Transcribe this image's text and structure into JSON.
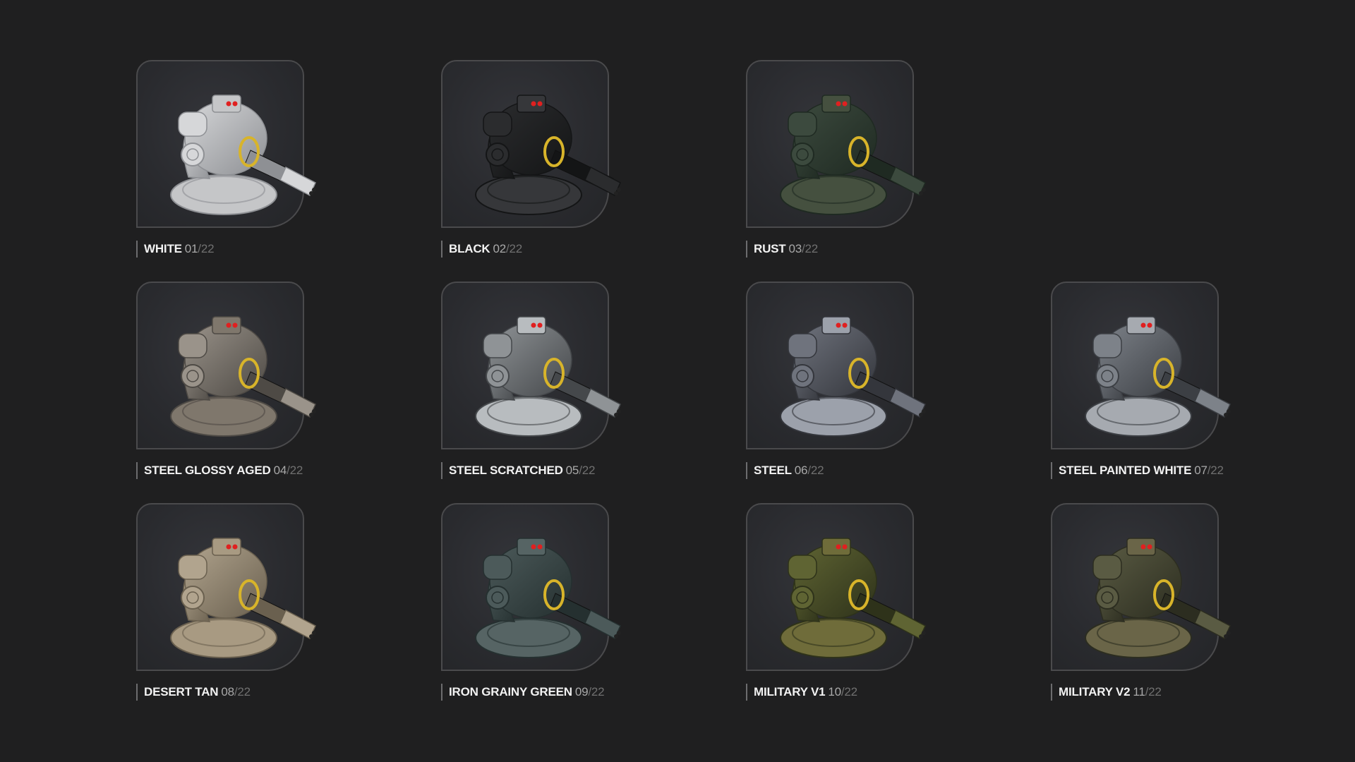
{
  "total": "/22",
  "variants": [
    {
      "name": "WHITE",
      "num": "01",
      "colors": {
        "body": "#d6d7d9",
        "dark": "#8e9094",
        "base": "#c5c6c8"
      }
    },
    {
      "name": "BLACK",
      "num": "02",
      "colors": {
        "body": "#2b2c2e",
        "dark": "#141516",
        "base": "#36373a"
      }
    },
    {
      "name": "RUST",
      "num": "03",
      "colors": {
        "body": "#3c4a3e",
        "dark": "#1f2a22",
        "base": "#45503f"
      }
    },
    {
      "name": "STEEL GLOSSY AGED",
      "num": "04",
      "colors": {
        "body": "#9a938a",
        "dark": "#4e4a45",
        "base": "#7f776c"
      }
    },
    {
      "name": "STEEL SCRATCHED",
      "num": "05",
      "colors": {
        "body": "#8f9396",
        "dark": "#45484b",
        "base": "#b8bcbf"
      }
    },
    {
      "name": "STEEL",
      "num": "06",
      "colors": {
        "body": "#6f737d",
        "dark": "#34363c",
        "base": "#9ca1ab"
      }
    },
    {
      "name": "STEEL PAINTED WHITE",
      "num": "07",
      "colors": {
        "body": "#7d8289",
        "dark": "#3c3f44",
        "base": "#a6aab0"
      }
    },
    {
      "name": "DESERT TAN",
      "num": "08",
      "colors": {
        "body": "#b1a48e",
        "dark": "#6a604f",
        "base": "#a89a82"
      }
    },
    {
      "name": "IRON GRAINY GREEN",
      "num": "09",
      "colors": {
        "body": "#4c5a5a",
        "dark": "#253030",
        "base": "#566464"
      }
    },
    {
      "name": "MILITARY V1",
      "num": "10",
      "colors": {
        "body": "#5f6433",
        "dark": "#2e321a",
        "base": "#6f6c3a"
      }
    },
    {
      "name": "MILITARY V2",
      "num": "11",
      "colors": {
        "body": "#5a5b43",
        "dark": "#2c2d20",
        "base": "#6a6548"
      }
    }
  ]
}
